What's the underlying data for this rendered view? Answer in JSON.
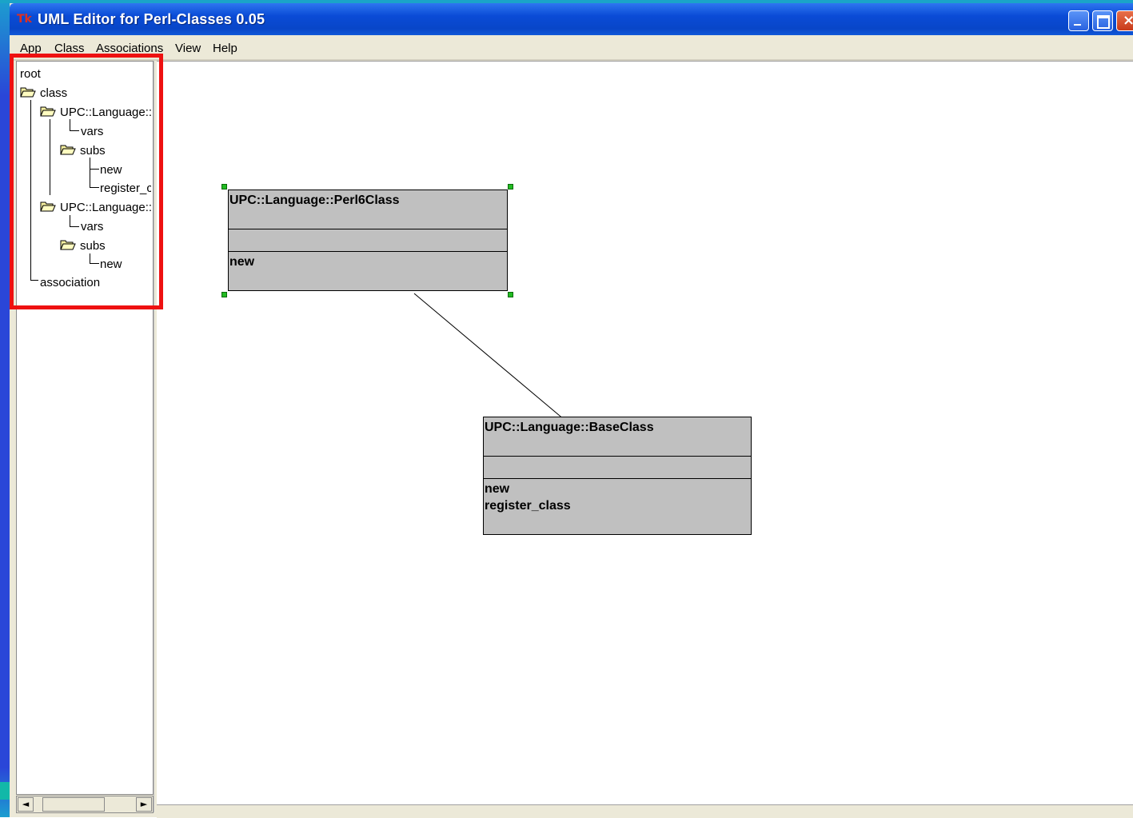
{
  "window": {
    "title": "UML Editor for Perl-Classes 0.05",
    "app_icon": "Tk"
  },
  "menu": [
    {
      "label": "App"
    },
    {
      "label": "Class"
    },
    {
      "label": "Associations"
    },
    {
      "label": "View"
    },
    {
      "label": "Help"
    }
  ],
  "tree": {
    "root": "root",
    "class": "class",
    "class1": "UPC::Language::",
    "class1_vars": "vars",
    "class1_subs": "subs",
    "class1_sub_new": "new",
    "class1_sub_register": "register_c",
    "class2": "UPC::Language::",
    "class2_vars": "vars",
    "class2_subs": "subs",
    "class2_sub_new": "new",
    "association": "association"
  },
  "scroll": {
    "left_arrow": "◄",
    "right_arrow": "►"
  },
  "diagram": {
    "class1": {
      "name": "UPC::Language::Perl6Class",
      "methods": [
        "new"
      ]
    },
    "class2": {
      "name": "UPC::Language::BaseClass",
      "methods": [
        "new",
        "register_class"
      ]
    }
  },
  "colors": {
    "titlebar": "#0846c8",
    "class_fill": "#c0c0c0",
    "handle": "#22bb22",
    "highlight": "#ee1111"
  }
}
